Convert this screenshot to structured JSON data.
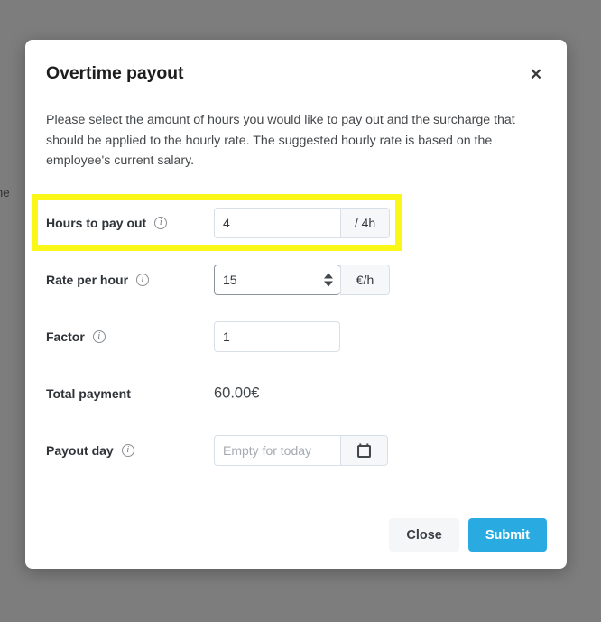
{
  "backdrop": {
    "partial_text": "me"
  },
  "modal": {
    "title": "Overtime payout",
    "close_icon": "close-icon",
    "description": "Please select the amount of hours you would like to pay out and the surcharge that should be applied to the hourly rate. The suggested hourly rate is based on the employee's current salary.",
    "rows": {
      "hours": {
        "label": "Hours to pay out",
        "info_icon": "info-icon",
        "value": "4",
        "suffix": "/ 4h"
      },
      "rate": {
        "label": "Rate per hour",
        "info_icon": "info-icon",
        "value": "15",
        "suffix": "€/h",
        "spinner_icon": "spinner-up-down-icon"
      },
      "factor": {
        "label": "Factor",
        "info_icon": "info-icon",
        "value": "1"
      },
      "total": {
        "label": "Total payment",
        "value": "60.00€"
      },
      "payout_day": {
        "label": "Payout day",
        "info_icon": "info-icon",
        "value": "",
        "placeholder": "Empty for today",
        "calendar_icon": "calendar-icon"
      }
    },
    "footer": {
      "close_label": "Close",
      "submit_label": "Submit"
    }
  },
  "colors": {
    "accent": "#29abe2",
    "highlight": "#FBF719",
    "overlay": "#636363",
    "suffix_bg": "#f5f7f9"
  }
}
